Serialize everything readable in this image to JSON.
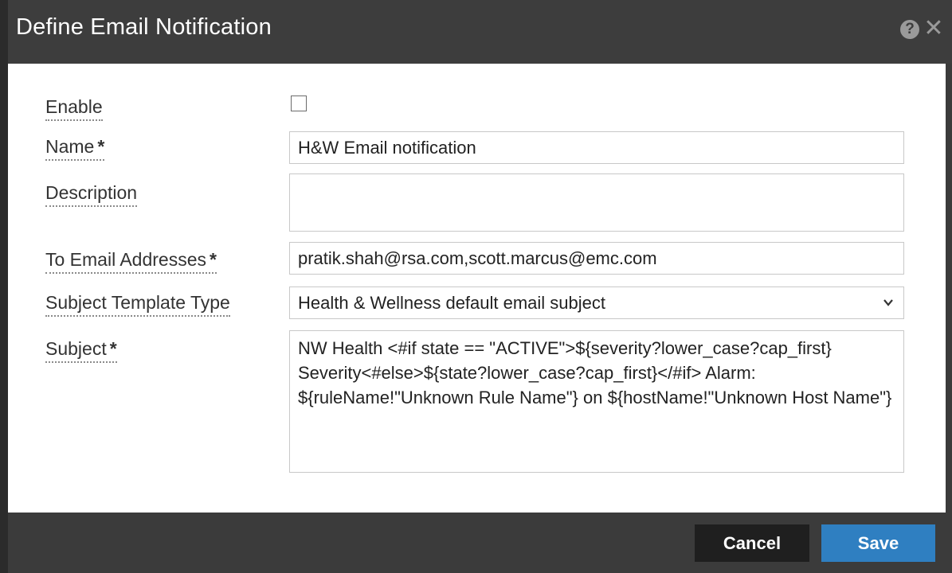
{
  "dialog": {
    "title": "Define Email Notification",
    "help_icon": "?",
    "close_icon": "✕"
  },
  "form": {
    "enable": {
      "label": "Enable",
      "checked": false
    },
    "name": {
      "label": "Name",
      "required_mark": "*",
      "value": "H&W Email notification"
    },
    "description": {
      "label": "Description",
      "value": ""
    },
    "to_email": {
      "label": "To Email Addresses",
      "required_mark": "*",
      "value": "pratik.shah@rsa.com,scott.marcus@emc.com"
    },
    "subject_template_type": {
      "label": "Subject Template Type",
      "value": "Health & Wellness default email subject"
    },
    "subject": {
      "label": "Subject",
      "required_mark": "*",
      "value": "NW Health <#if state == \"ACTIVE\">${severity?lower_case?cap_first} Severity<#else>${state?lower_case?cap_first}</#if> Alarm: ${ruleName!\"Unknown Rule Name\"} on ${hostName!\"Unknown Host Name\"}"
    }
  },
  "footer": {
    "cancel_label": "Cancel",
    "save_label": "Save"
  },
  "colors": {
    "title_bar": "#3d3d3d",
    "save_button": "#2f7fc1",
    "cancel_button": "#1f1f1f"
  }
}
